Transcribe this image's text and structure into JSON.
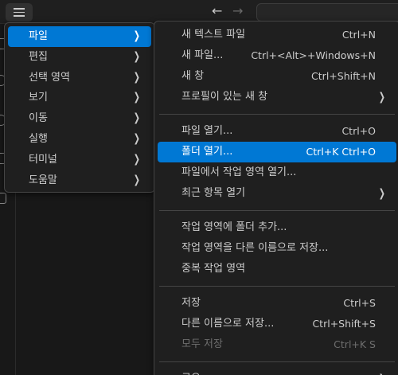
{
  "window": {
    "nav_back": "←",
    "nav_forward": "→"
  },
  "main_menu": {
    "items": [
      {
        "label": "파일",
        "selected": true
      },
      {
        "label": "편집"
      },
      {
        "label": "선택 영역"
      },
      {
        "label": "보기"
      },
      {
        "label": "이동"
      },
      {
        "label": "실행"
      },
      {
        "label": "터미널"
      },
      {
        "label": "도움말"
      }
    ],
    "chevron": "❯"
  },
  "file_menu": {
    "groups": [
      [
        {
          "label": "새 텍스트 파일",
          "shortcut": "Ctrl+N"
        },
        {
          "label": "새 파일...",
          "shortcut": "Ctrl+<Alt>+Windows+N"
        },
        {
          "label": "새 창",
          "shortcut": "Ctrl+Shift+N"
        },
        {
          "label": "프로필이 있는 새 창",
          "submenu": true
        }
      ],
      [
        {
          "label": "파일 열기...",
          "shortcut": "Ctrl+O"
        },
        {
          "label": "폴더 열기...",
          "shortcut": "Ctrl+K Ctrl+O",
          "selected": true
        },
        {
          "label": "파일에서 작업 영역 열기..."
        },
        {
          "label": "최근 항목 열기",
          "submenu": true
        }
      ],
      [
        {
          "label": "작업 영역에 폴더 추가..."
        },
        {
          "label": "작업 영역을 다른 이름으로 저장..."
        },
        {
          "label": "중복 작업 영역"
        }
      ],
      [
        {
          "label": "저장",
          "shortcut": "Ctrl+S"
        },
        {
          "label": "다른 이름으로 저장...",
          "shortcut": "Ctrl+Shift+S"
        },
        {
          "label": "모두 저장",
          "shortcut": "Ctrl+K S",
          "disabled": true
        }
      ],
      [
        {
          "label": "공유",
          "submenu": true
        }
      ]
    ]
  },
  "colors": {
    "selection": "#0078d4",
    "menu_bg": "#1f1f1f",
    "menu_border": "#454545"
  }
}
